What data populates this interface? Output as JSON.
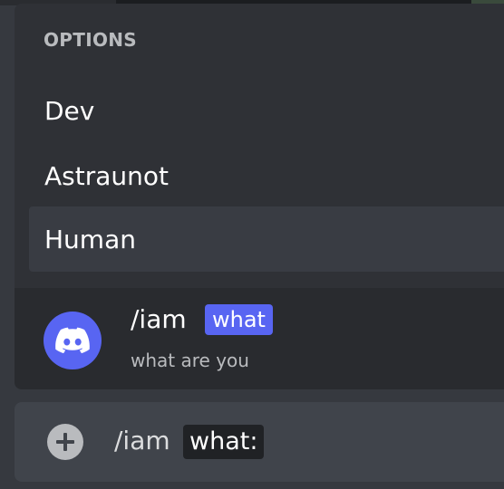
{
  "options": {
    "header": "OPTIONS",
    "items": [
      {
        "label": "Dev"
      },
      {
        "label": "Astraunot"
      },
      {
        "label": "Human"
      }
    ],
    "selected_index": 2
  },
  "command": {
    "name": "/iam",
    "param": "what",
    "description": "what are you",
    "avatar_icon": "discord-logo-icon"
  },
  "input": {
    "add_icon": "plus-circle-icon",
    "command": "/iam",
    "param": "what:"
  },
  "colors": {
    "background": "#36393f",
    "popup": "#2f3136",
    "command_panel": "#292b2f",
    "accent": "#5865f2",
    "input_bar": "#40444b"
  }
}
